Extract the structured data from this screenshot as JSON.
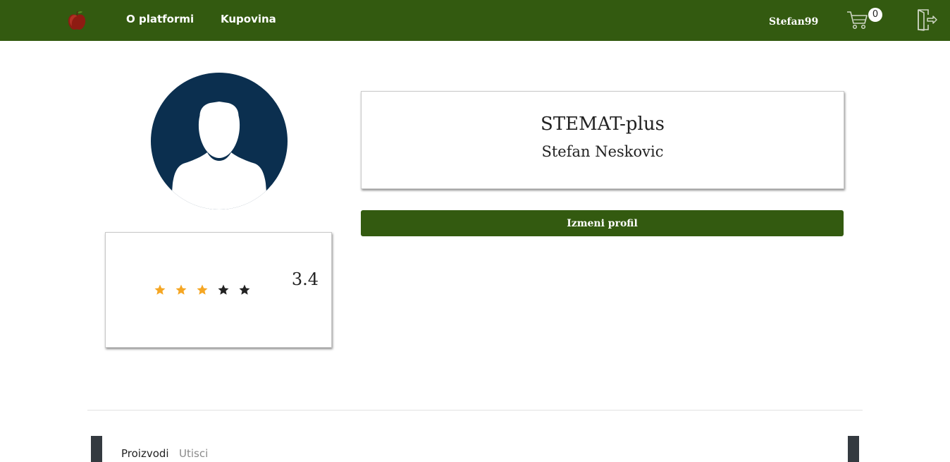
{
  "nav": {
    "logo_icon": "apple-logo-icon",
    "links": [
      "O platformi",
      "Kupovina"
    ],
    "username": "Stefan99",
    "cart_count": "0",
    "cart_icon": "cart-icon",
    "logout_icon": "logout-door-icon",
    "background_color": "#335a10"
  },
  "profile": {
    "avatar_icon": "user-avatar-icon",
    "avatar_color": "#0b2f4f",
    "shop_name": "STEMAT-plus",
    "owner_name": "Stefan Neskovic",
    "edit_button_label": "Izmeni profil"
  },
  "rating": {
    "value": "3.4",
    "stars_filled": 3,
    "stars_total": 5,
    "filled_color": "#f5a623",
    "empty_color": "#222222"
  },
  "tabs": {
    "items": [
      "Proizvodi",
      "Utisci"
    ],
    "active": "Proizvodi"
  }
}
